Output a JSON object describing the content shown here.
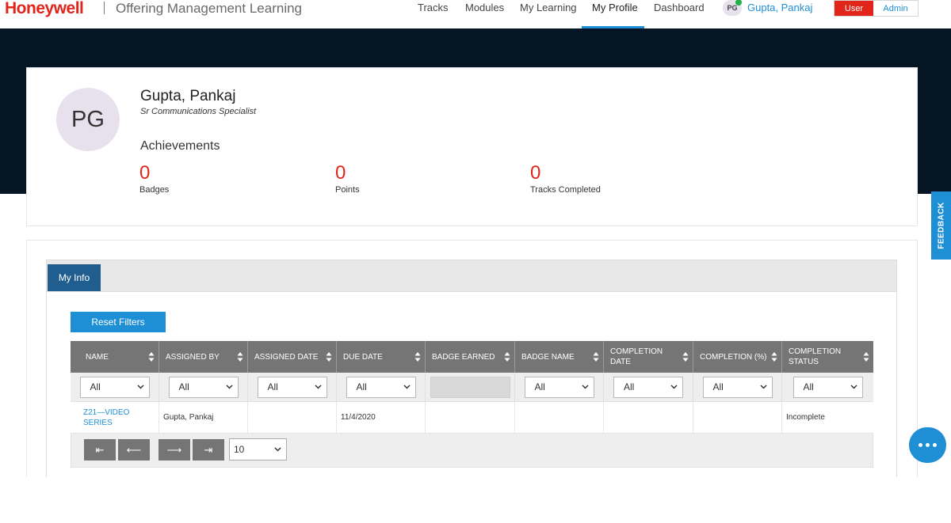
{
  "header": {
    "logo_text": "Honeywell",
    "app_title": "Offering Management Learning",
    "nav": [
      "Tracks",
      "Modules",
      "My Learning",
      "My Profile",
      "Dashboard"
    ],
    "active_nav": "My Profile",
    "user_initials": "PG",
    "user_name": "Gupta, Pankaj",
    "role_user": "User",
    "role_admin": "Admin"
  },
  "profile": {
    "initials": "PG",
    "name": "Gupta, Pankaj",
    "title": "Sr Communications Specialist",
    "achievements_heading": "Achievements",
    "stats": [
      {
        "value": "0",
        "label": "Badges"
      },
      {
        "value": "0",
        "label": "Points"
      },
      {
        "value": "0",
        "label": "Tracks Completed"
      }
    ]
  },
  "feedback_label": "FEEDBACK",
  "tabs": [
    "My Info"
  ],
  "reset_filters_label": "Reset Filters",
  "table": {
    "columns": [
      "NAME",
      "ASSIGNED BY",
      "ASSIGNED DATE",
      "DUE DATE",
      "BADGE EARNED",
      "BADGE NAME",
      "COMPLETION DATE",
      "COMPLETION (%)",
      "COMPLETION STATUS"
    ],
    "filters": [
      "All",
      "All",
      "All",
      "All",
      "",
      "All",
      "All",
      "All",
      "All"
    ],
    "rows": [
      [
        "Z21—VIDEO SERIES",
        "Gupta, Pankaj",
        "",
        "11/4/2020",
        "",
        "",
        "",
        "",
        "Incomplete"
      ]
    ]
  },
  "pager": {
    "first": "⇤",
    "prev": "⟵",
    "next": "⟶",
    "last": "⇥",
    "page_size": "10"
  },
  "colors": {
    "brand_red": "#e1251b",
    "accent_blue": "#1e8fd5",
    "banner": "#061523",
    "tab_active": "#1f5e8e",
    "table_header": "#757575"
  }
}
